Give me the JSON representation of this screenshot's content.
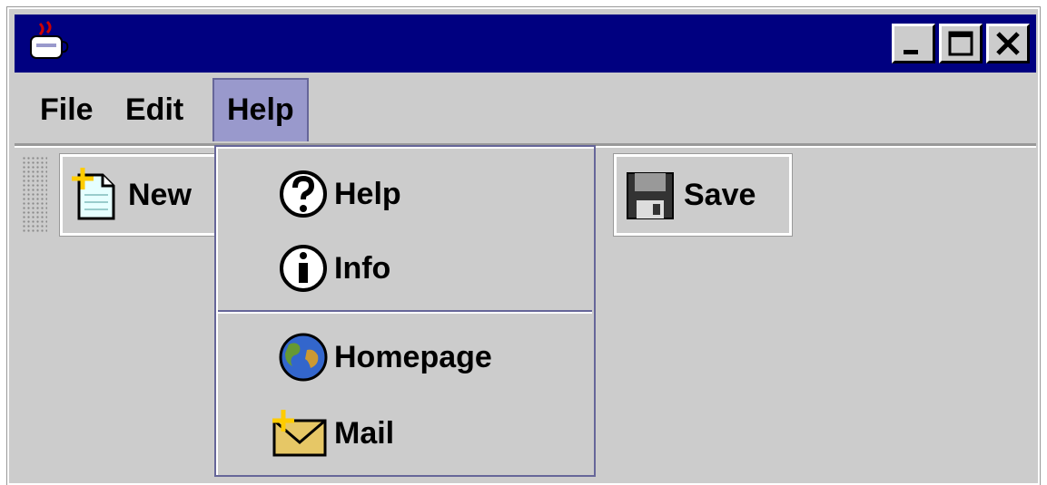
{
  "window": {
    "icon": "java-cup-icon",
    "controls": [
      "minimize-icon",
      "maximize-icon",
      "close-icon"
    ]
  },
  "menubar": {
    "items": [
      {
        "label": "File"
      },
      {
        "label": "Edit"
      },
      {
        "label": "Help",
        "active": true
      }
    ]
  },
  "toolbar": {
    "new_label": "New",
    "save_label": "Save"
  },
  "help_menu": {
    "items": [
      {
        "label": "Help",
        "icon": "question-icon"
      },
      {
        "label": "Info",
        "icon": "info-icon"
      },
      {
        "label": "Homepage",
        "icon": "globe-icon"
      },
      {
        "label": "Mail",
        "icon": "mail-icon"
      }
    ]
  },
  "colors": {
    "titlebar": "#000080",
    "face": "#cccccc",
    "menu_highlight": "#9999cc",
    "menu_border": "#666699"
  }
}
